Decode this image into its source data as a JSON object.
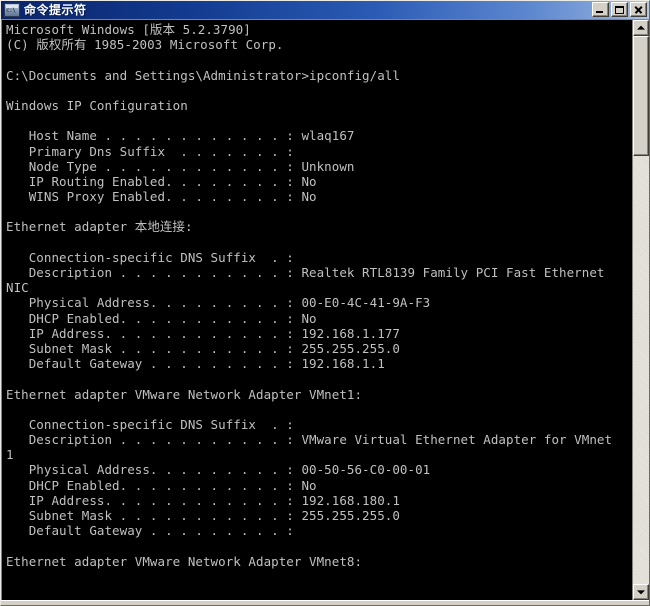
{
  "window": {
    "title": "命令提示符",
    "icon": "console-icon",
    "buttons": {
      "minimize": "Minimize",
      "maximize": "Maximize",
      "close": "Close"
    }
  },
  "scrollbar": {
    "up_label": "Scroll up",
    "down_label": "Scroll down",
    "thumb_label": "Scroll thumb"
  },
  "console": {
    "background_color": "#000000",
    "text_color": "#c0c0c0",
    "lines": [
      "Microsoft Windows [版本 5.2.3790]",
      "(C) 版权所有 1985-2003 Microsoft Corp.",
      "",
      "C:\\Documents and Settings\\Administrator>ipconfig/all",
      "",
      "Windows IP Configuration",
      "",
      "   Host Name . . . . . . . . . . . . : wlaq167",
      "   Primary Dns Suffix  . . . . . . . :",
      "   Node Type . . . . . . . . . . . . : Unknown",
      "   IP Routing Enabled. . . . . . . . : No",
      "   WINS Proxy Enabled. . . . . . . . : No",
      "",
      "Ethernet adapter 本地连接:",
      "",
      "   Connection-specific DNS Suffix  . :",
      "   Description . . . . . . . . . . . : Realtek RTL8139 Family PCI Fast Ethernet",
      "NIC",
      "   Physical Address. . . . . . . . . : 00-E0-4C-41-9A-F3",
      "   DHCP Enabled. . . . . . . . . . . : No",
      "   IP Address. . . . . . . . . . . . : 192.168.1.177",
      "   Subnet Mask . . . . . . . . . . . : 255.255.255.0",
      "   Default Gateway . . . . . . . . . : 192.168.1.1",
      "",
      "Ethernet adapter VMware Network Adapter VMnet1:",
      "",
      "   Connection-specific DNS Suffix  . :",
      "   Description . . . . . . . . . . . : VMware Virtual Ethernet Adapter for VMnet",
      "1",
      "   Physical Address. . . . . . . . . : 00-50-56-C0-00-01",
      "   DHCP Enabled. . . . . . . . . . . : No",
      "   IP Address. . . . . . . . . . . . : 192.168.180.1",
      "   Subnet Mask . . . . . . . . . . . : 255.255.255.0",
      "   Default Gateway . . . . . . . . . :",
      "",
      "Ethernet adapter VMware Network Adapter VMnet8:"
    ]
  }
}
